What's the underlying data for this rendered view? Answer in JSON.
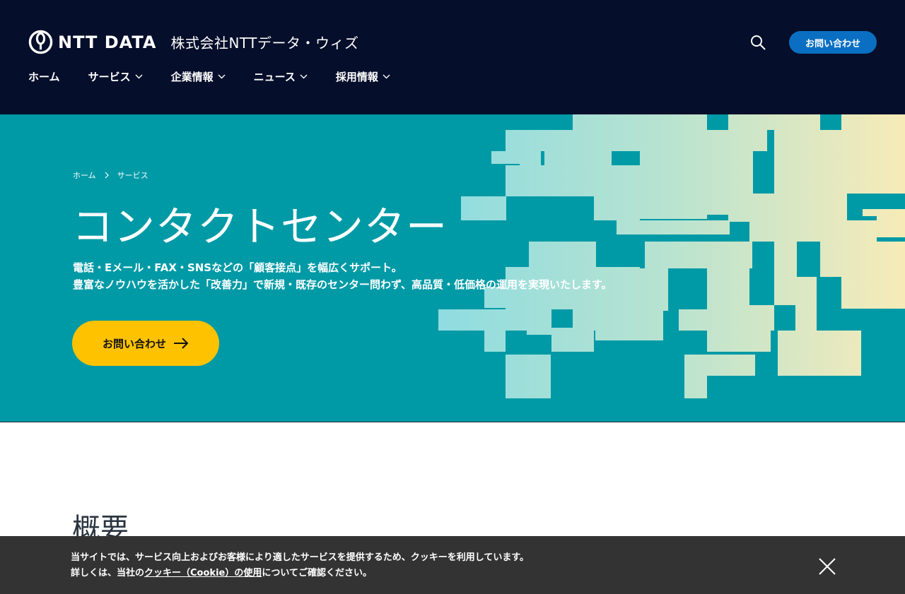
{
  "header": {
    "logo_text": "NTT DATA",
    "company_name": "株式会社NTTデータ・ウィズ",
    "contact_label": "お問い合わせ",
    "search_icon": "search-icon",
    "background": "#050e2a"
  },
  "nav": {
    "items": [
      {
        "label": "ホーム",
        "has_dropdown": false
      },
      {
        "label": "サービス",
        "has_dropdown": true
      },
      {
        "label": "企業情報",
        "has_dropdown": true
      },
      {
        "label": "ニュース",
        "has_dropdown": true
      },
      {
        "label": "採用情報",
        "has_dropdown": true
      }
    ]
  },
  "hero": {
    "breadcrumb": [
      "ホーム",
      "サービス"
    ],
    "title": "コンタクトセンター",
    "description_line1": "電話・Eメール・FAX・SNSなどの「顧客接点」を幅広くサポート。",
    "description_line2": "豊富なノウハウを活かした「改善力」で新規・既存のセンター問わず、高品質・低価格の運用を実現いたします。",
    "cta_label": "お問い合わせ",
    "background": "#009aa6",
    "cta_color": "#ffc200"
  },
  "main": {
    "section_title": "概要"
  },
  "cookie": {
    "line1": "当サイトでは、サービス向上およびお客様により適したサービスを提供するため、クッキーを利用しています。",
    "line2_prefix": "詳しくは、当社の",
    "link_text": "クッキー（Cookie）の使用",
    "line2_suffix": "についてご確認ください。",
    "close_icon": "close-icon"
  },
  "colors": {
    "accent_blue": "#0a6fc2",
    "map_light": "#8fdce0",
    "map_warm": "#f7ebb8"
  }
}
